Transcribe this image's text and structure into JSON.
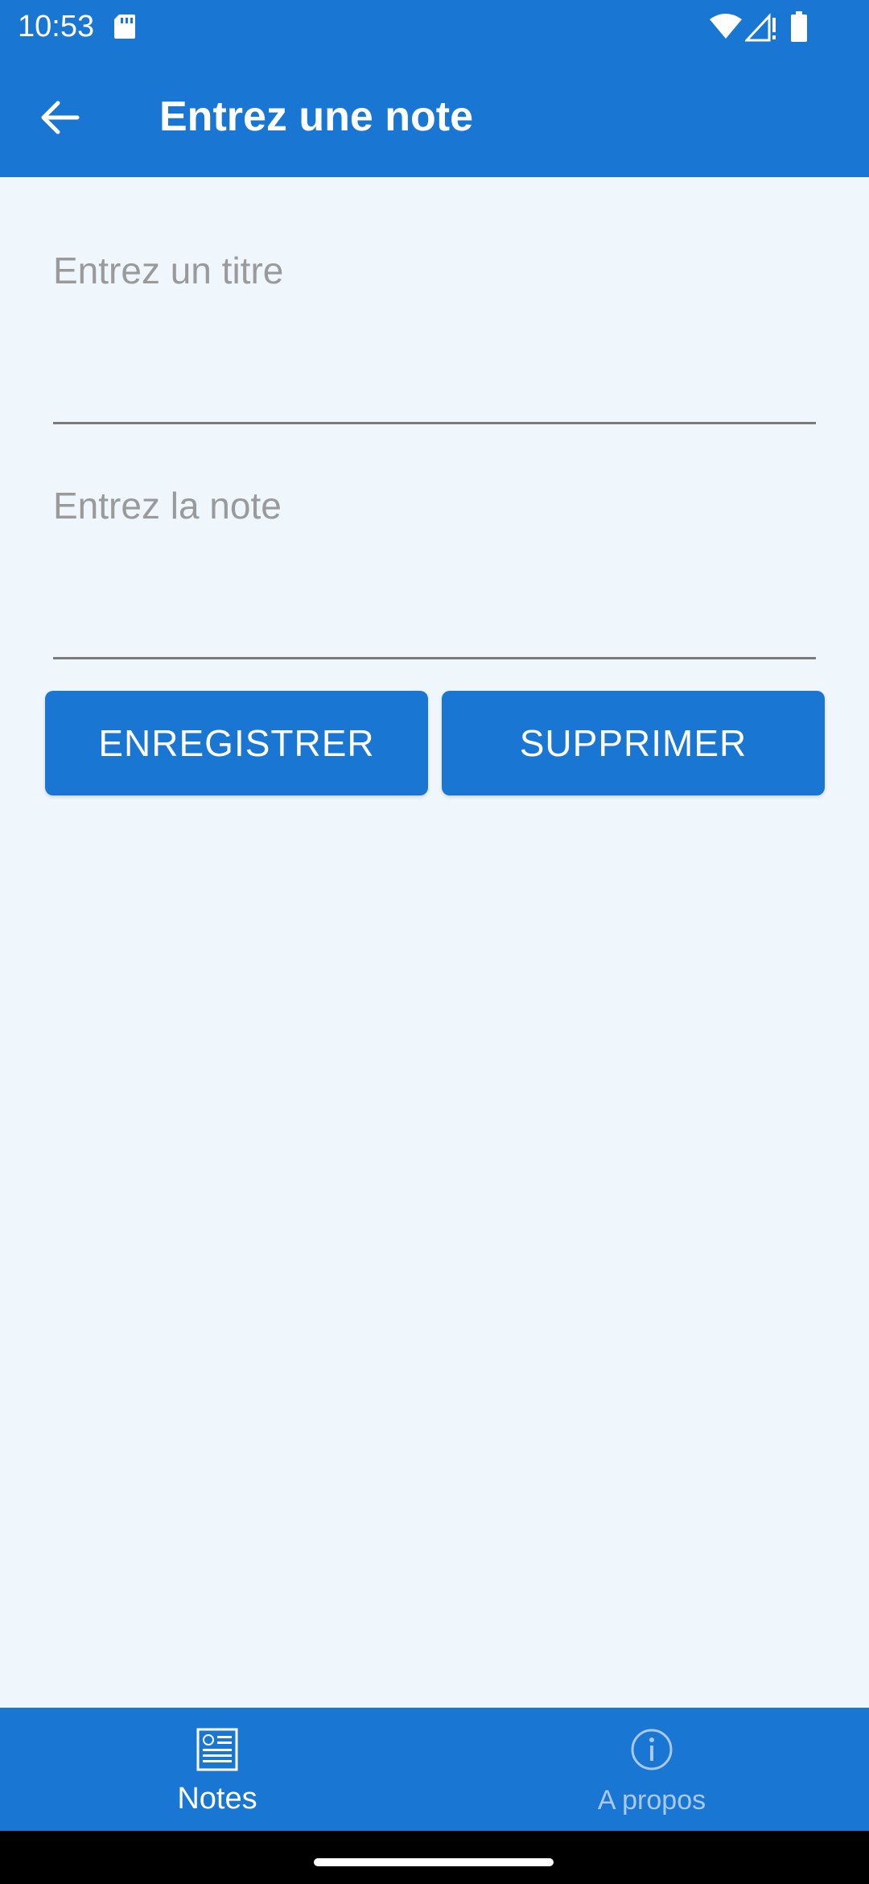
{
  "status_bar": {
    "time": "10:53",
    "icons": [
      "sd-card-icon",
      "wifi-icon",
      "signal-icon",
      "battery-icon"
    ]
  },
  "app_bar": {
    "title": "Entrez une note",
    "back_icon": "arrow-back-icon"
  },
  "form": {
    "title_placeholder": "Entrez un titre",
    "title_value": "",
    "note_placeholder": "Entrez la note",
    "note_value": ""
  },
  "buttons": {
    "save_label": "ENREGISTRER",
    "delete_label": "SUPPRIMER"
  },
  "bottom_nav": {
    "items": [
      {
        "label": "Notes",
        "icon": "notes-icon",
        "selected": true
      },
      {
        "label": "A propos",
        "icon": "info-icon",
        "selected": false
      }
    ]
  },
  "colors": {
    "primary": "#1976D2",
    "background": "#EFF7FD",
    "inactive_tab": "#A9C9EC"
  }
}
